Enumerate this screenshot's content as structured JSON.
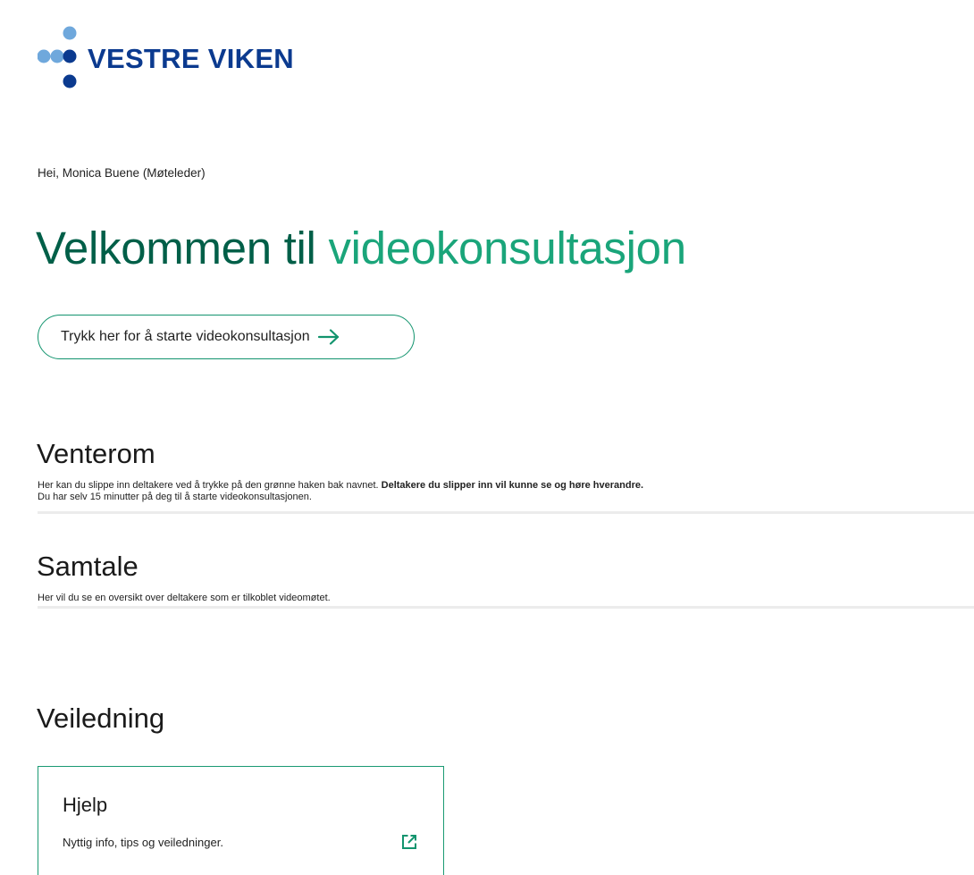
{
  "brand": {
    "name": "VESTRE VIKEN",
    "colors": {
      "navy": "#0b3a8f",
      "light_blue": "#6fa8dc",
      "accent_green": "#1aa57a",
      "dark_green": "#005f48"
    }
  },
  "greeting": "Hei, Monica Buene (Møteleder)",
  "welcome": {
    "part1": "Velkommen til ",
    "part2": "videokonsultasjon"
  },
  "start_button": {
    "label": "Trykk her for å starte videokonsultasjon",
    "icon": "arrow-right-icon"
  },
  "waiting_room": {
    "title": "Venterom",
    "desc_plain": "Her kan du slippe inn deltakere ved å trykke på den grønne haken bak navnet. ",
    "desc_bold": "Deltakere du slipper inn vil kunne se og høre hverandre.",
    "desc_line2": "Du har selv 15 minutter på deg til å starte videokonsultasjonen."
  },
  "conversation": {
    "title": "Samtale",
    "desc": "Her vil du se en oversikt over deltakere som er tilkoblet videomøtet."
  },
  "guidance": {
    "title": "Veiledning",
    "card": {
      "title": "Hjelp",
      "desc": "Nyttig info, tips og veiledninger.",
      "icon": "external-link-icon"
    }
  }
}
